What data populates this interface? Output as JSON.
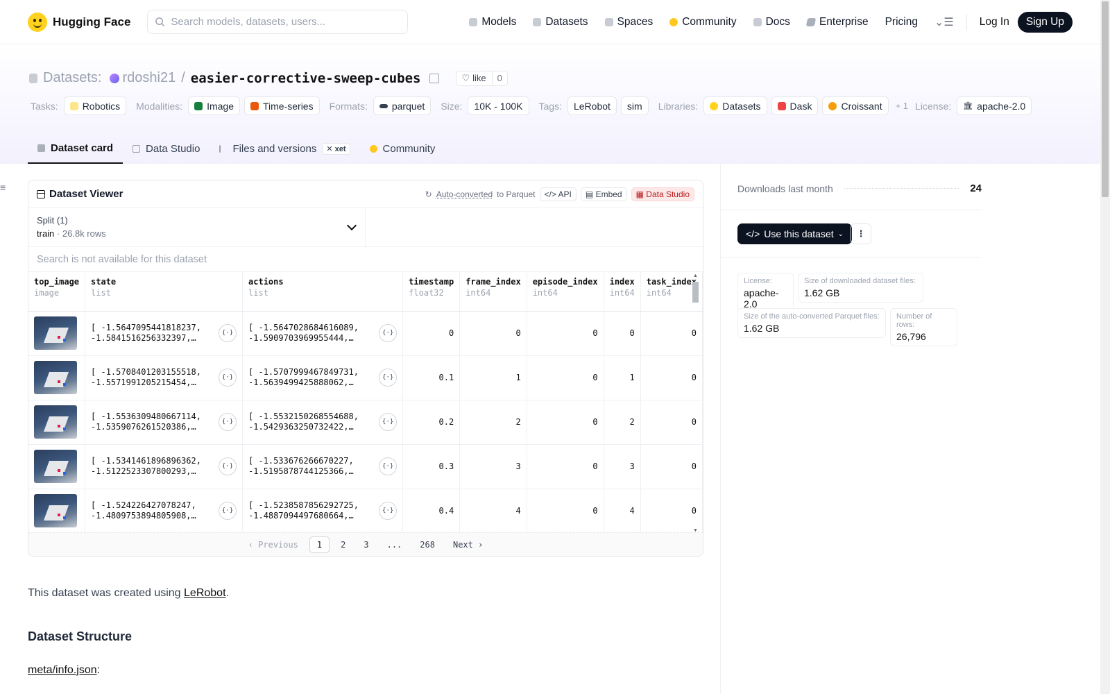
{
  "nav": {
    "brand": "Hugging Face",
    "search_placeholder": "Search models, datasets, users...",
    "links": [
      "Models",
      "Datasets",
      "Spaces",
      "Community",
      "Docs",
      "Enterprise",
      "Pricing"
    ],
    "login": "Log In",
    "signup": "Sign Up"
  },
  "header": {
    "prefix": "Datasets:",
    "owner": "rdoshi21",
    "slash": "/",
    "repo": "easier-corrective-sweep-cubes",
    "like_label": "like",
    "like_count": "0",
    "tags": {
      "tasks_label": "Tasks:",
      "tasks": [
        "Robotics"
      ],
      "modalities_label": "Modalities:",
      "modalities": [
        "Image",
        "Time-series"
      ],
      "formats_label": "Formats:",
      "formats": [
        "parquet"
      ],
      "size_label": "Size:",
      "size": [
        "10K - 100K"
      ],
      "tags_label": "Tags:",
      "tags": [
        "LeRobot",
        "sim"
      ],
      "libraries_label": "Libraries:",
      "libraries": [
        "Datasets",
        "Dask",
        "Croissant"
      ],
      "libraries_more": "+ 1",
      "license_label": "License:",
      "license": "apache-2.0"
    },
    "tabs": [
      "Dataset card",
      "Data Studio",
      "Files and versions",
      "Community"
    ],
    "xet_badge": "xet"
  },
  "viewer": {
    "title": "Dataset Viewer",
    "autoconv_link": "Auto-converted",
    "autoconv_suffix": "to Parquet",
    "api": "API",
    "embed": "Embed",
    "studio": "Data Studio",
    "split_label": "Split (1)",
    "split_name": "train",
    "split_dot": "·",
    "split_rows": "26.8k rows",
    "search_na": "Search is not available for this dataset",
    "columns": [
      {
        "name": "top_image",
        "type": "image"
      },
      {
        "name": "state",
        "type": "list"
      },
      {
        "name": "actions",
        "type": "list"
      },
      {
        "name": "timestamp",
        "type": "float32"
      },
      {
        "name": "frame_index",
        "type": "int64"
      },
      {
        "name": "episode_index",
        "type": "int64"
      },
      {
        "name": "index",
        "type": "int64"
      },
      {
        "name": "task_index",
        "type": "int64"
      }
    ],
    "rows": [
      {
        "state1": "[ -1.5647095441818237,",
        "state2": "-1.5841516256332397,…",
        "act1": "[ -1.5647028684616089,",
        "act2": "-1.5909703969955444,…",
        "timestamp": "0",
        "frame_index": "0",
        "episode_index": "0",
        "index": "0",
        "task_index": "0"
      },
      {
        "state1": "[ -1.5708401203155518,",
        "state2": "-1.5571991205215454,…",
        "act1": "[ -1.5707999467849731,",
        "act2": "-1.5639499425888062,…",
        "timestamp": "0.1",
        "frame_index": "1",
        "episode_index": "0",
        "index": "1",
        "task_index": "0"
      },
      {
        "state1": "[ -1.5536309480667114,",
        "state2": "-1.5359076261520386,…",
        "act1": "[ -1.5532150268554688,",
        "act2": "-1.5429363250732422,…",
        "timestamp": "0.2",
        "frame_index": "2",
        "episode_index": "0",
        "index": "2",
        "task_index": "0"
      },
      {
        "state1": "[ -1.5341461896896362,",
        "state2": "-1.5122523307800293,…",
        "act1": "[ -1.533676266670227,",
        "act2": "-1.5195878744125366,…",
        "timestamp": "0.3",
        "frame_index": "3",
        "episode_index": "0",
        "index": "3",
        "task_index": "0"
      },
      {
        "state1": "[ -1.524226427078247,",
        "state2": "-1.4809753894805908,…",
        "act1": "[ -1.5238587856292725,",
        "act2": "-1.4887094497680664,…",
        "timestamp": "0.4",
        "frame_index": "4",
        "episode_index": "0",
        "index": "4",
        "task_index": "0"
      }
    ],
    "json_icon_text": "{·}",
    "pager": {
      "prev": "Previous",
      "pages": [
        "1",
        "2",
        "3",
        "...",
        "268"
      ],
      "next": "Next",
      "current": "1"
    }
  },
  "card": {
    "intro_prefix": "This dataset was created using ",
    "intro_link": "LeRobot",
    "intro_suffix": ".",
    "structure_heading": "Dataset Structure",
    "meta_link": "meta/info.json",
    "meta_suffix": ":"
  },
  "sidebar": {
    "downloads_label": "Downloads last month",
    "downloads_value": "24",
    "use_button": "Use this dataset",
    "stats": [
      {
        "k": "License:",
        "v": "apache-2.0"
      },
      {
        "k": "Size of downloaded dataset files:",
        "v": "1.62 GB"
      },
      {
        "k": "Size of the auto-converted Parquet files:",
        "v": "1.62 GB"
      },
      {
        "k": "Number of rows:",
        "v": "26,796"
      }
    ]
  },
  "colors": {
    "brand_yellow": "#ffd21e",
    "dark_button": "#0b1220",
    "studio_red": "#b91c1c"
  }
}
